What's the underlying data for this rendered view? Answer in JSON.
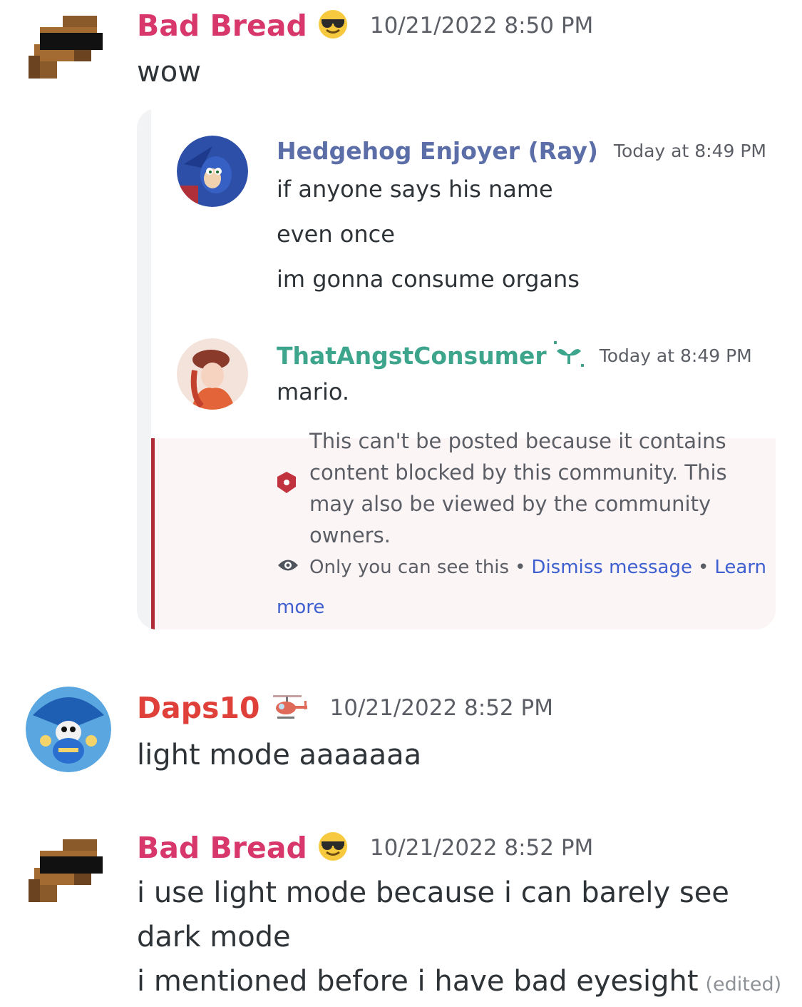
{
  "messages": [
    {
      "username": "Bad Bread",
      "username_color": "#d8376b",
      "emoji": "sunglasses-emoji",
      "timestamp": "10/21/2022 8:50 PM",
      "lines": [
        "wow"
      ]
    },
    {
      "username": "Daps10",
      "username_color": "#e0403a",
      "emoji": "helicopter-emoji",
      "timestamp": "10/21/2022 8:52 PM",
      "lines": [
        "light mode aaaaaaa"
      ]
    },
    {
      "username": "Bad Bread",
      "username_color": "#d8376b",
      "emoji": "sunglasses-emoji",
      "timestamp": "10/21/2022 8:52 PM",
      "lines": [
        "i use light mode because i can barely see",
        "dark mode",
        "i mentioned before i have bad eyesight"
      ],
      "edited": "(edited)"
    }
  ],
  "embed": {
    "message1": {
      "username": "Hedgehog Enjoyer (Ray)",
      "username_color": "#5b6ea8",
      "timestamp": "Today at 8:49 PM",
      "lines": [
        "if anyone says his name",
        "even once",
        "im gonna consume organs"
      ]
    },
    "message2": {
      "username": "ThatAngstConsumer",
      "username_color": "#3ea58d",
      "badge": "sprout-icon",
      "timestamp": "Today at 8:49 PM",
      "text": "mario.",
      "blocked_notice": [
        "This can't be posted because it contains",
        "content blocked by this community. This",
        "may also be viewed by the community",
        "owners."
      ],
      "only_you": "Only you can see this",
      "bullet": "•",
      "dismiss": "Dismiss message",
      "learn": "Learn",
      "more": "more"
    }
  },
  "colors": {
    "blocked_bar": "#b02a37",
    "link": "#3e5fcf",
    "pink_bg": "#fbf5f6"
  }
}
